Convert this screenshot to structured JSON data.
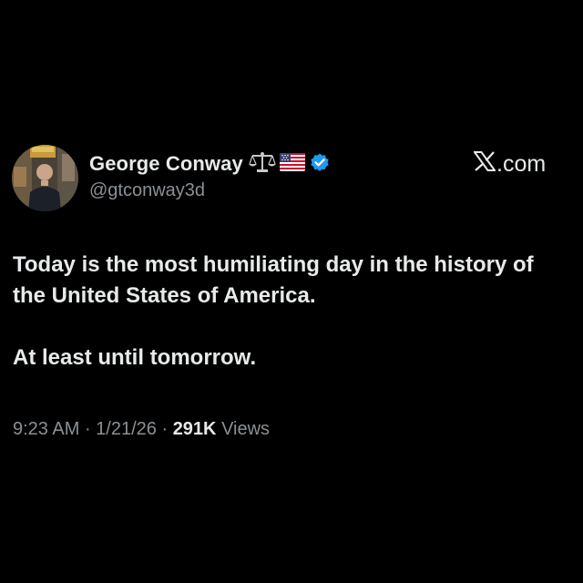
{
  "author": {
    "display_name": "George Conway",
    "handle": "@gtconway3d",
    "name_emojis": [
      "scales-icon",
      "us-flag-icon"
    ],
    "verified_badge": "verified-badge-icon",
    "verified_color": "#1d9bf0"
  },
  "brand": {
    "site": "X.com",
    "site_suffix": ".com",
    "logo": "x-logo-icon"
  },
  "tweet": {
    "paragraphs": [
      "Today is the most humiliating day in the history of the United States of America.",
      "At least until tomorrow."
    ]
  },
  "meta": {
    "time": "9:23 AM",
    "separator": " · ",
    "date": "1/21/26",
    "views_count": "291K",
    "views_label": "Views"
  },
  "colors": {
    "background": "#000000",
    "text_primary": "#e7e9ea",
    "text_secondary": "#8b9095"
  }
}
